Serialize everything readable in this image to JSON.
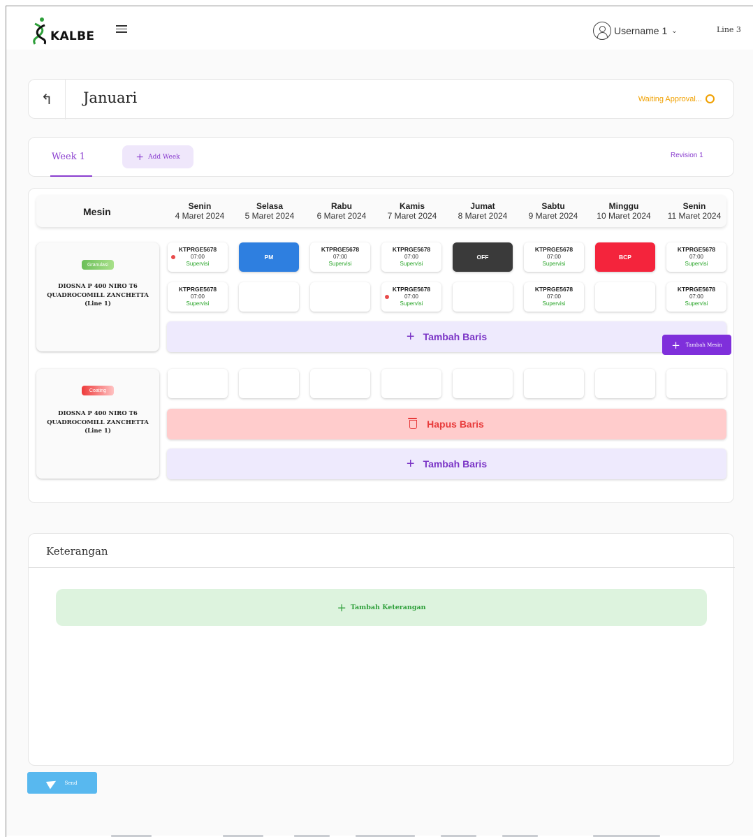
{
  "header": {
    "logo_text": "KALBE",
    "user_name": "Username 1",
    "line": "Line 3",
    "colors": {
      "brand": "#7b35c6",
      "logo_green": "#2e9f3a"
    }
  },
  "title_bar": {
    "title": "Januari",
    "status": "Waiting Approval...",
    "status_color": "#f0a000"
  },
  "tabs": {
    "weeks": [
      {
        "label": "Week 1"
      }
    ],
    "add_week_label": "Add Week",
    "revision_label": "Revision 1"
  },
  "schedule": {
    "machine_header": "Mesin",
    "days": [
      {
        "name": "Senin",
        "date": "4 Maret 2024"
      },
      {
        "name": "Selasa",
        "date": "5 Maret 2024"
      },
      {
        "name": "Rabu",
        "date": "6 Maret 2024"
      },
      {
        "name": "Kamis",
        "date": "7 Maret 2024"
      },
      {
        "name": "Jumat",
        "date": "8 Maret 2024"
      },
      {
        "name": "Sabtu",
        "date": "9 Maret 2024"
      },
      {
        "name": "Minggu",
        "date": "10 Maret 2024"
      },
      {
        "name": "Senin",
        "date": "11 Maret 2024"
      }
    ],
    "machines": [
      {
        "tag": "Granulasi",
        "name": "DIOSNA P 400 NIRO T6 QUADROCOMILL ZANCHETTA (Line 1)",
        "rows": [
          [
            {
              "type": "shift",
              "code": "KTPRGE5678",
              "time": "07:00",
              "role": "Supervisi",
              "alert": true
            },
            {
              "type": "PM",
              "label": "PM"
            },
            {
              "type": "shift",
              "code": "KTPRGE5678",
              "time": "07:00",
              "role": "Supervisi",
              "alert": false
            },
            {
              "type": "shift",
              "code": "KTPRGE5678",
              "time": "07:00",
              "role": "Supervisi",
              "alert": false
            },
            {
              "type": "OFF",
              "label": "OFF"
            },
            {
              "type": "shift",
              "code": "KTPRGE5678",
              "time": "07:00",
              "role": "Supervisi",
              "alert": false
            },
            {
              "type": "BCP",
              "label": "BCP"
            },
            {
              "type": "shift",
              "code": "KTPRGE5678",
              "time": "07:00",
              "role": "Supervisi",
              "alert": false
            }
          ],
          [
            {
              "type": "shift",
              "code": "KTPRGE5678",
              "time": "07:00",
              "role": "Supervisi",
              "alert": false
            },
            {
              "type": "empty"
            },
            {
              "type": "empty"
            },
            {
              "type": "shift",
              "code": "KTPRGE5678",
              "time": "07:00",
              "role": "Supervisi",
              "alert": true
            },
            {
              "type": "empty"
            },
            {
              "type": "shift",
              "code": "KTPRGE5678",
              "time": "07:00",
              "role": "Supervisi",
              "alert": false
            },
            {
              "type": "empty"
            },
            {
              "type": "shift",
              "code": "KTPRGE5678",
              "time": "07:00",
              "role": "Supervisi",
              "alert": false
            }
          ]
        ],
        "add_row_label": "Tambah Baris"
      },
      {
        "tag": "Coating",
        "name": "DIOSNA P 400 NIRO T6 QUADROCOMILL ZANCHETTA (Line 1)",
        "rows": [
          [
            {
              "type": "empty"
            },
            {
              "type": "empty"
            },
            {
              "type": "empty"
            },
            {
              "type": "empty"
            },
            {
              "type": "empty"
            },
            {
              "type": "empty"
            },
            {
              "type": "empty"
            },
            {
              "type": "empty"
            }
          ]
        ],
        "delete_row_label": "Hapus Baris",
        "add_row_label": "Tambah Baris"
      }
    ],
    "add_machine_label": "Tambah Mesin",
    "cell_colors": {
      "PM": "#2e7fe0",
      "OFF": "#3a3a3a",
      "BCP": "#f4243c"
    }
  },
  "keterangan": {
    "title": "Keterangan",
    "add_label": "Tambah Keterangan"
  },
  "send_label": "Send"
}
